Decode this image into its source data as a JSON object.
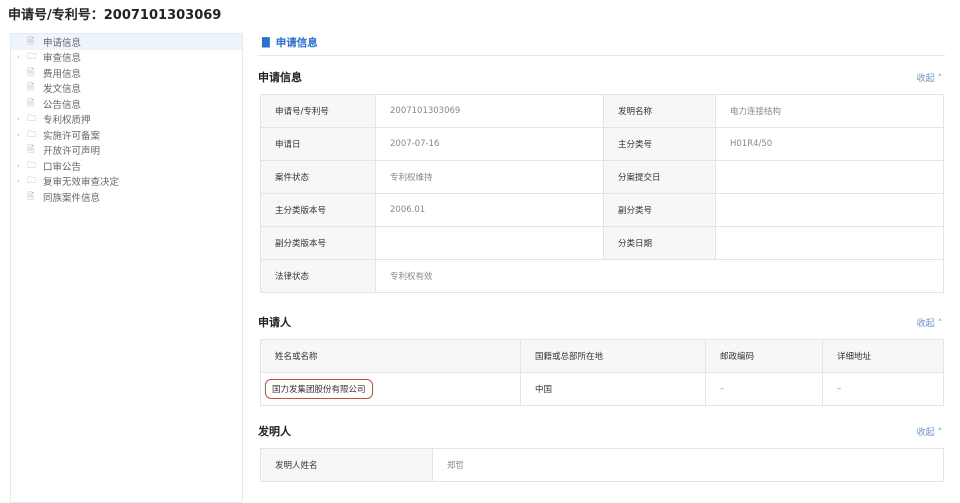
{
  "page_title": "申请号/专利号：2007101303069",
  "sidebar": {
    "items": [
      {
        "label": "申请信息",
        "folder": false
      },
      {
        "label": "审查信息",
        "folder": true
      },
      {
        "label": "费用信息",
        "folder": false
      },
      {
        "label": "发文信息",
        "folder": false
      },
      {
        "label": "公告信息",
        "folder": false
      },
      {
        "label": "专利权质押",
        "folder": true
      },
      {
        "label": "实施许可备案",
        "folder": true
      },
      {
        "label": "开放许可声明",
        "folder": false
      },
      {
        "label": "口审公告",
        "folder": true
      },
      {
        "label": "复审无效审查决定",
        "folder": true
      },
      {
        "label": "同族案件信息",
        "folder": false
      }
    ]
  },
  "main": {
    "header": "申请信息",
    "collapse": "收起 ˄",
    "app_section": {
      "title": "申请信息",
      "rows": [
        [
          "申请号/专利号",
          "2007101303069",
          "发明名称",
          "电力连接结构"
        ],
        [
          "申请日",
          "2007-07-16",
          "主分类号",
          "H01R4/50"
        ],
        [
          "案件状态",
          "专利权维持",
          "分案提交日",
          ""
        ],
        [
          "主分类版本号",
          "2006.01",
          "副分类号",
          ""
        ],
        [
          "副分类版本号",
          "",
          "分类日期",
          ""
        ]
      ],
      "legal_label": "法律状态",
      "legal_value": "专利权有效"
    },
    "applicant": {
      "title": "申请人",
      "headers": [
        "姓名或名称",
        "国籍或总部所在地",
        "邮政编码",
        "详细地址"
      ],
      "row": [
        "国力发集团股份有限公司",
        "中国",
        "–",
        "–"
      ]
    },
    "inventor": {
      "title": "发明人",
      "label": "发明人姓名",
      "value": "郑哲"
    }
  }
}
